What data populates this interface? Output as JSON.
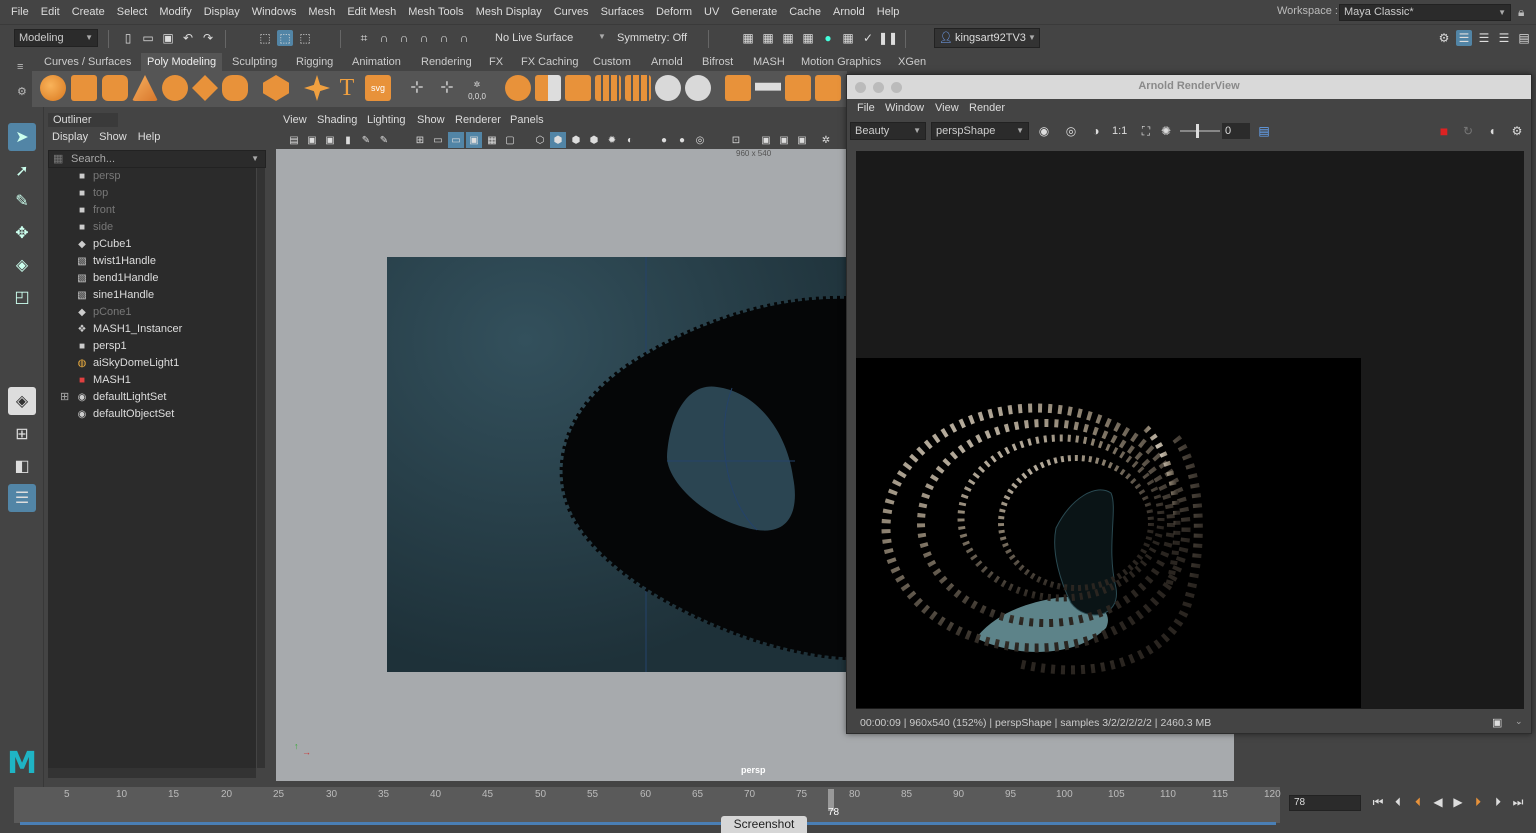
{
  "menubar": {
    "items": [
      "File",
      "Edit",
      "Create",
      "Select",
      "Modify",
      "Display",
      "Windows",
      "Mesh",
      "Edit Mesh",
      "Mesh Tools",
      "Mesh Display",
      "Curves",
      "Surfaces",
      "Deform",
      "UV",
      "Generate",
      "Cache",
      "Arnold",
      "Help"
    ],
    "workspace_label": "Workspace :",
    "workspace_value": "Maya Classic*"
  },
  "statusline": {
    "menuset": "Modeling",
    "live_surface": "No Live Surface",
    "symmetry": "Symmetry: Off",
    "user": "kingsart92TV3"
  },
  "shelf": {
    "tabs": [
      "Curves / Surfaces",
      "Poly Modeling",
      "Sculpting",
      "Rigging",
      "Animation",
      "Rendering",
      "FX",
      "FX Caching",
      "Custom",
      "Arnold",
      "Bifrost",
      "MASH",
      "Motion Graphics",
      "XGen"
    ],
    "active_tab": "Poly Modeling",
    "text_icon": "T",
    "svg_icon": "svg",
    "coord_icon": "0,0,0"
  },
  "outliner": {
    "title": "Outliner",
    "menu": [
      "Display",
      "Show",
      "Help"
    ],
    "search_placeholder": "Search...",
    "items": [
      {
        "label": "persp",
        "icon": "camera-icon",
        "dim": true
      },
      {
        "label": "top",
        "icon": "camera-icon",
        "dim": true
      },
      {
        "label": "front",
        "icon": "camera-icon",
        "dim": true
      },
      {
        "label": "side",
        "icon": "camera-icon",
        "dim": true
      },
      {
        "label": "pCube1",
        "icon": "mesh-icon",
        "dim": false
      },
      {
        "label": "twist1Handle",
        "icon": "deformer-icon",
        "dim": false
      },
      {
        "label": "bend1Handle",
        "icon": "deformer-icon",
        "dim": false
      },
      {
        "label": "sine1Handle",
        "icon": "deformer-icon",
        "dim": false
      },
      {
        "label": "pCone1",
        "icon": "mesh-icon",
        "dim": true
      },
      {
        "label": "MASH1_Instancer",
        "icon": "instancer-icon",
        "dim": false
      },
      {
        "label": "persp1",
        "icon": "camera-icon",
        "dim": false
      },
      {
        "label": "aiSkyDomeLight1",
        "icon": "skydome-icon",
        "dim": false
      },
      {
        "label": "MASH1",
        "icon": "mash-icon",
        "dim": false
      },
      {
        "label": "defaultLightSet",
        "icon": "set-icon",
        "dim": false
      },
      {
        "label": "defaultObjectSet",
        "icon": "set-icon",
        "dim": false
      }
    ]
  },
  "viewport": {
    "menu": [
      "View",
      "Shading",
      "Lighting",
      "Show",
      "Renderer",
      "Panels"
    ],
    "resolution": "960 x 540",
    "camera_label": "persp"
  },
  "arnold": {
    "title": "Arnold RenderView",
    "menu": [
      "File",
      "Window",
      "View",
      "Render"
    ],
    "aov": "Beauty",
    "camera": "perspShape",
    "ratio": "1:1",
    "exposure": "0",
    "status": "00:00:09 | 960x540 (152%) | perspShape | samples 3/2/2/2/2/2 | 2460.3 MB"
  },
  "timeline": {
    "ticks": [
      "5",
      "10",
      "15",
      "20",
      "25",
      "30",
      "35",
      "40",
      "45",
      "50",
      "55",
      "60",
      "65",
      "70",
      "75",
      "80",
      "85",
      "90",
      "95",
      "100",
      "105",
      "110",
      "115",
      "120"
    ],
    "current_frame": "78",
    "current_frame_field": "78"
  },
  "taskbar": {
    "tooltip": "Screenshot"
  }
}
